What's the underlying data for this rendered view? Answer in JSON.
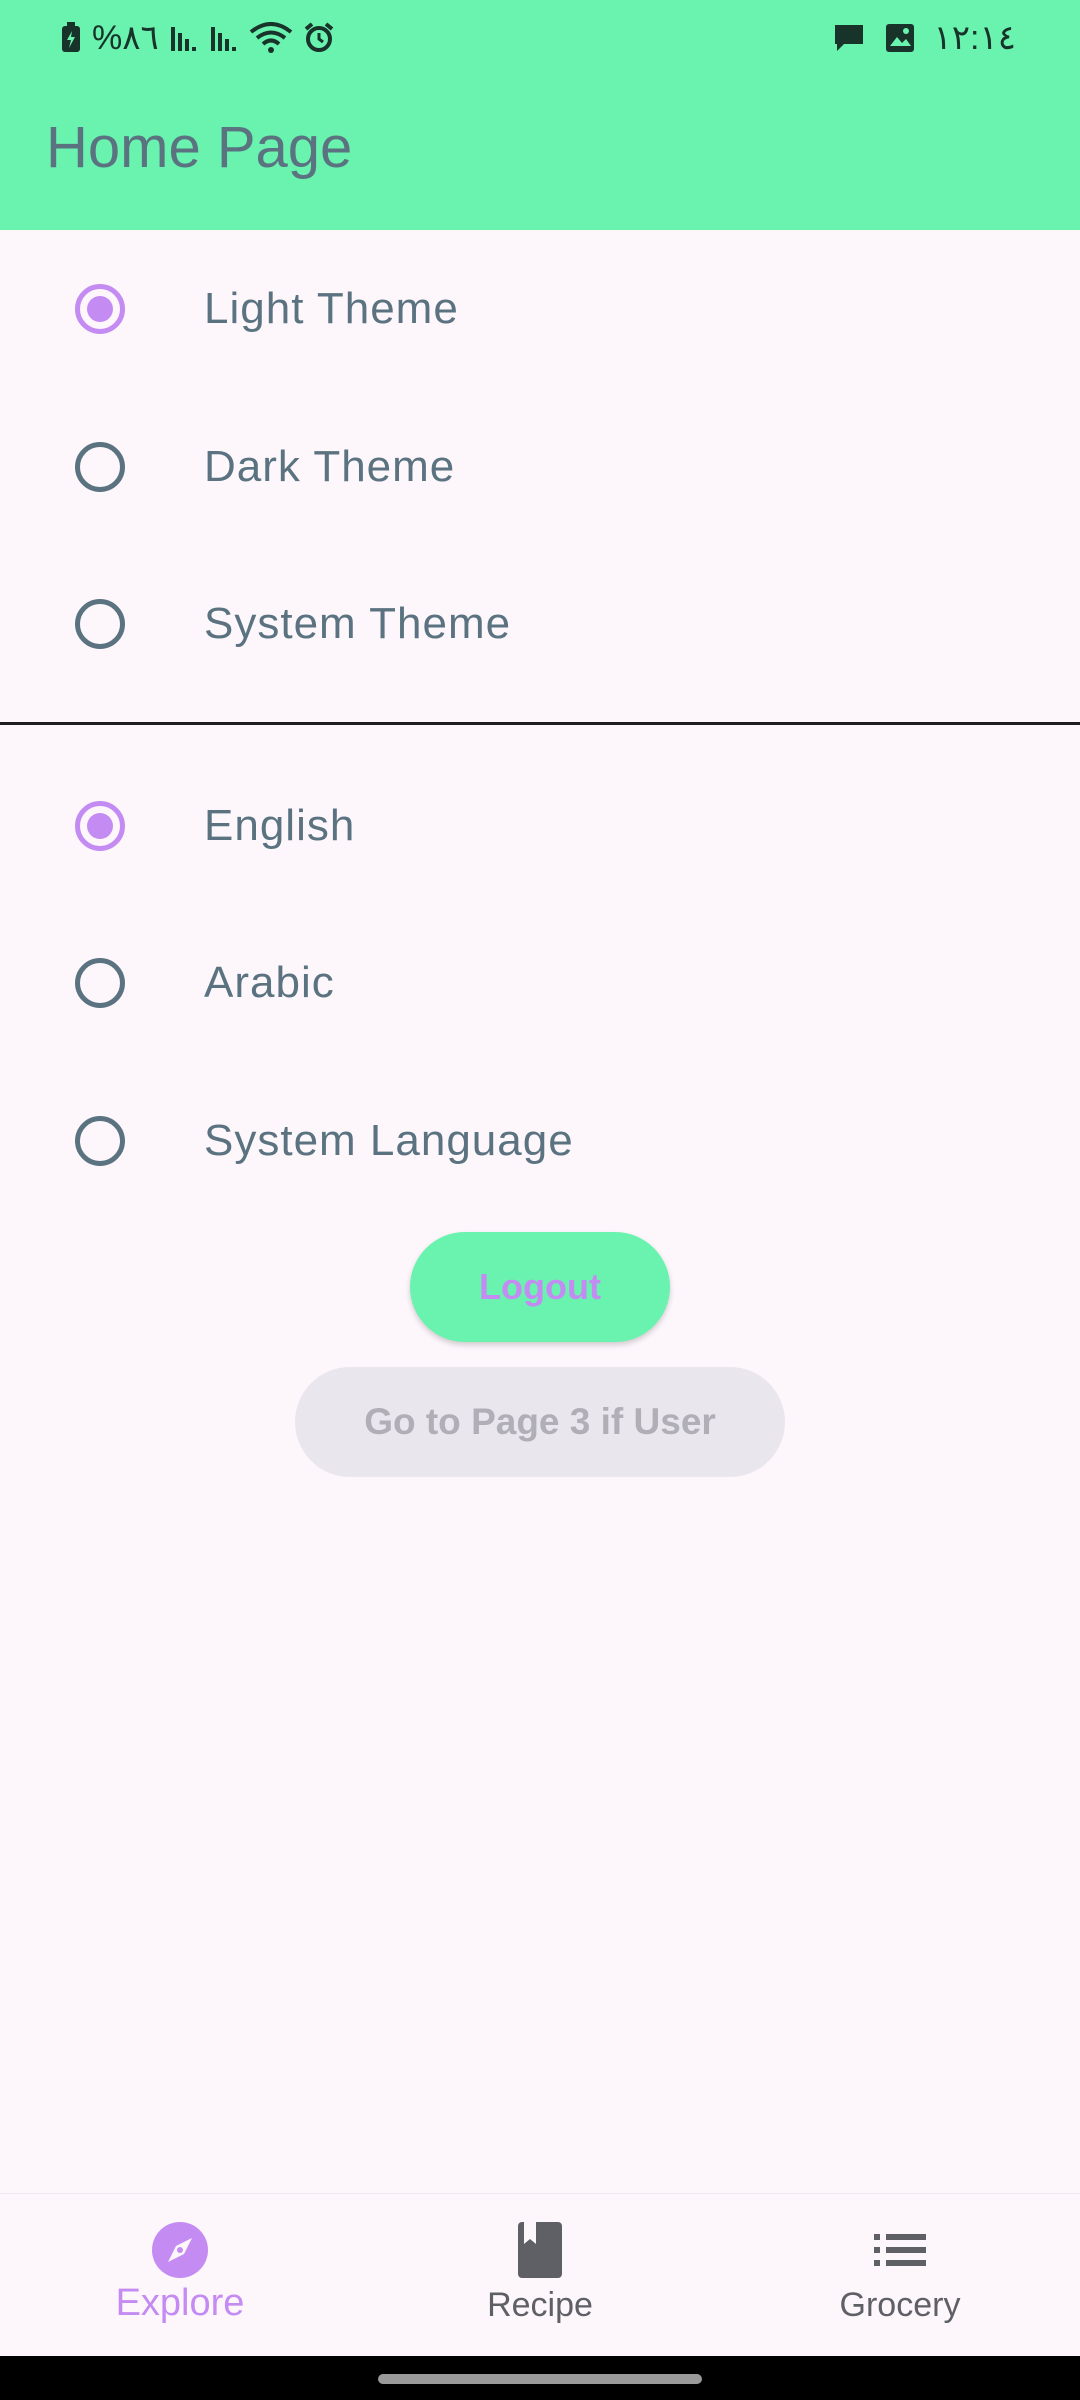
{
  "status_bar": {
    "battery_percent": "%٨٦",
    "time": "١٢:١٤",
    "icons_left": [
      "battery-charging-icon",
      "signal-icon",
      "signal-icon",
      "wifi-icon",
      "alarm-icon"
    ],
    "icons_right": [
      "chat-icon",
      "image-icon"
    ]
  },
  "app_bar": {
    "title": "Home Page"
  },
  "theme_options": [
    {
      "label": "Light Theme",
      "selected": true
    },
    {
      "label": "Dark Theme",
      "selected": false
    },
    {
      "label": "System Theme",
      "selected": false
    }
  ],
  "language_options": [
    {
      "label": "English",
      "selected": true
    },
    {
      "label": "Arabic",
      "selected": false
    },
    {
      "label": "System Language",
      "selected": false
    }
  ],
  "buttons": {
    "logout": "Logout",
    "go_to_page3": "Go to Page 3 if User"
  },
  "bottom_nav": {
    "items": [
      {
        "label": "Explore",
        "icon": "compass-icon",
        "active": true
      },
      {
        "label": "Recipe",
        "icon": "book-icon",
        "active": false
      },
      {
        "label": "Grocery",
        "icon": "list-icon",
        "active": false
      }
    ]
  },
  "colors": {
    "primary": "#6AF2AF",
    "accent": "#C48CF2",
    "background": "#FDF7FC",
    "text": "#5B7380"
  }
}
